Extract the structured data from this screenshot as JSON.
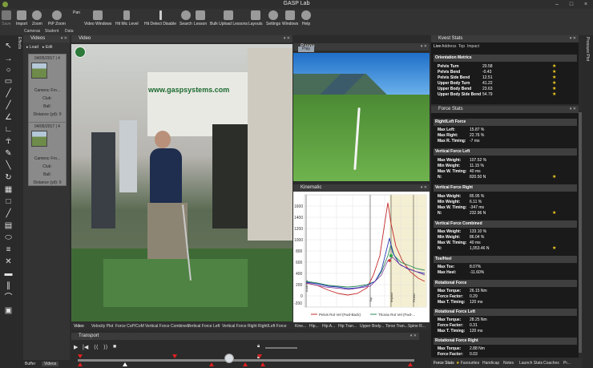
{
  "window": {
    "title": "GASP Lab",
    "min": "–",
    "max": "□",
    "close": "×"
  },
  "ribbon": {
    "buttons": [
      {
        "label": "Save",
        "icon": "save-icon"
      },
      {
        "label": "Import",
        "icon": "import-icon"
      },
      {
        "label": "Zoom",
        "icon": "zoom-icon"
      },
      {
        "label": "PiP Zoom",
        "icon": "pip-zoom-icon"
      },
      {
        "label": "Pan",
        "icon": "pan-icon"
      },
      {
        "label": "Video Windows",
        "icon": "video-windows-icon"
      },
      {
        "label": "Hit Mic Level",
        "icon": "mic-icon"
      },
      {
        "label": "Hit Detect Disable",
        "icon": "hit-detect-icon"
      },
      {
        "label": "Search",
        "icon": "search-icon"
      },
      {
        "label": "Lesson",
        "icon": "lesson-icon"
      },
      {
        "label": "Bulk Upload Lessons",
        "icon": "bulk-upload-icon"
      },
      {
        "label": "Layouts",
        "icon": "layouts-icon"
      },
      {
        "label": "Settings",
        "icon": "gear-icon"
      },
      {
        "label": "Windows",
        "icon": "windows-icon"
      },
      {
        "label": "Help",
        "icon": "help-icon"
      }
    ],
    "row2": [
      "Cameras",
      "Student",
      "Data"
    ]
  },
  "left_tabs": {
    "effects": "Effects"
  },
  "videos": {
    "title": "Videos",
    "load": "Load",
    "edit": "Edit",
    "items": [
      {
        "date": "04/05/2017 | 4",
        "camera": "Camera: Fro...",
        "club": "Club:",
        "ball": "Ball:",
        "distance": "Distance (yd): 0"
      },
      {
        "date": "04/05/2017 | 4",
        "camera": "Camera: Fro...",
        "club": "Club:",
        "ball": "Ball:",
        "distance": "Distance (yd): 0"
      }
    ]
  },
  "video": {
    "title": "Video",
    "banner": "www.gaspsystems.com"
  },
  "range": {
    "title": "Range",
    "play": "Play"
  },
  "kinematic": {
    "title": "Kinematic",
    "legend": [
      "Pelvis Rot Vel (Fwd-Back)",
      "Thorax Rot Vel (Fwd-..."
    ],
    "yticks": [
      "1600",
      "1400",
      "1200",
      "1000",
      "800",
      "600",
      "400",
      "200",
      "0",
      "-200",
      "-400"
    ],
    "phases": [
      "Address",
      "Top",
      "Impact",
      "Finish"
    ]
  },
  "kvest": {
    "title": "Kvest Stats",
    "tabs": [
      "Live",
      "Address",
      "Top",
      "Impact"
    ],
    "orientation": {
      "title": "Orientation Metrics",
      "rows": [
        {
          "k": "Pelvis Turn",
          "v": "20.58"
        },
        {
          "k": "Pelvis Bend",
          "v": "-0.43"
        },
        {
          "k": "Pelvis Side Bend",
          "v": "12.51"
        },
        {
          "k": "Upper Body Turn",
          "v": "41.22"
        },
        {
          "k": "Upper Body Bend",
          "v": "23.63"
        },
        {
          "k": "Upper Body Side Bend",
          "v": "54.79"
        }
      ]
    }
  },
  "force": {
    "title": "Force Stats",
    "sections": [
      {
        "title": "Right/Left Force",
        "rows": [
          {
            "k": "Max Left:",
            "v": "15.87 %"
          },
          {
            "k": "Max Right:",
            "v": "22.76 %"
          },
          {
            "k": "Max R. Timing:",
            "v": "-7 ms"
          }
        ]
      },
      {
        "title": "Vertical Force Left",
        "rows": [
          {
            "k": "Max Weight:",
            "v": "107.52 %"
          },
          {
            "k": "Min Weight:",
            "v": "11.15 %"
          },
          {
            "k": "Max W. Timing:",
            "v": "40 ms"
          },
          {
            "k": "N:",
            "v": "820.50 N"
          }
        ]
      },
      {
        "title": "Vertical Force Right",
        "rows": [
          {
            "k": "Max Weight:",
            "v": "85.95 %"
          },
          {
            "k": "Min Weight:",
            "v": "6.11 %"
          },
          {
            "k": "Max W. Timing:",
            "v": "-347 ms"
          },
          {
            "k": "N:",
            "v": "232.96 N"
          }
        ]
      },
      {
        "title": "Vertical Force Combined",
        "rows": [
          {
            "k": "Max Weight:",
            "v": "133.10 %"
          },
          {
            "k": "Min Weight:",
            "v": "86.04 %"
          },
          {
            "k": "Max W. Timing:",
            "v": "40 ms"
          },
          {
            "k": "N:",
            "v": "1,053.46 N"
          }
        ]
      },
      {
        "title": "Toe/Heel",
        "rows": [
          {
            "k": "Max Toe:",
            "v": "8.07%"
          },
          {
            "k": "Max Heel:",
            "v": "-11.60%"
          }
        ]
      },
      {
        "title": "Rotational Force",
        "rows": [
          {
            "k": "Max Torque:",
            "v": "26.15 Nm"
          },
          {
            "k": "Force Factor:",
            "v": "0.29"
          },
          {
            "k": "Max T. Timing:",
            "v": "120 ms"
          }
        ]
      },
      {
        "title": "Rotational Force Left",
        "rows": [
          {
            "k": "Max Torque:",
            "v": "28.25 Nm"
          },
          {
            "k": "Force Factor:",
            "v": "0.31"
          },
          {
            "k": "Max T. Timing:",
            "v": "120 ms"
          }
        ]
      },
      {
        "title": "Rotational Force Right",
        "rows": [
          {
            "k": "Max Torque:",
            "v": "2.88 Nm"
          },
          {
            "k": "Force Factor:",
            "v": "0.03"
          }
        ]
      }
    ]
  },
  "right_tab": "Pressure Plot",
  "bottom_tabs": [
    "Video",
    "Velocity Plot",
    "Force CoP/CoM",
    "Vertical Force Combined",
    "Vertical Force Left",
    "Vertical Force Right",
    "Right/Left Force",
    "Kine...",
    "Hip...",
    "Hip A...",
    "Hip Tran...",
    "Upper Body...",
    "Torso Tran...",
    "Spine R..."
  ],
  "stat_tabs": [
    "Force Stats",
    "Favourites",
    "Handicap",
    "Notes",
    "Launch Stats",
    "Coaches",
    "Pr..."
  ],
  "transport": {
    "title": "Transport"
  },
  "left_bottom_tabs": [
    "Buffer",
    "Videos"
  ]
}
